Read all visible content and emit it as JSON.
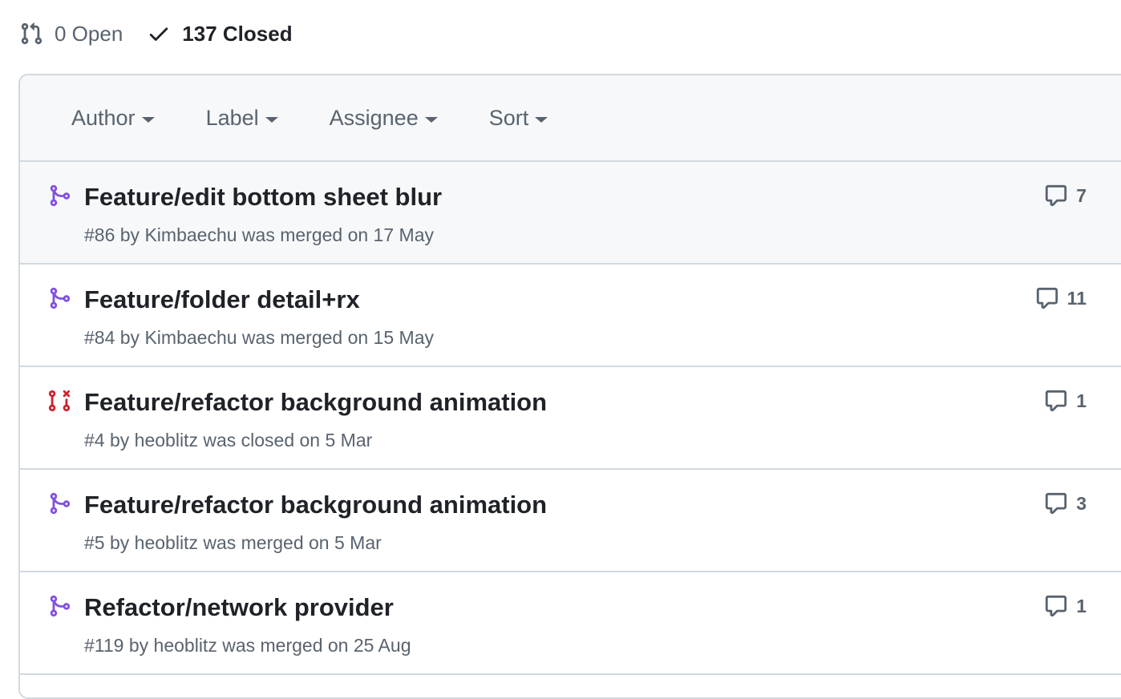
{
  "states": {
    "open_label": "0 Open",
    "closed_label": "137 Closed"
  },
  "filters": {
    "author": "Author",
    "label": "Label",
    "assignee": "Assignee",
    "sort": "Sort"
  },
  "colors": {
    "merged": "#8250df",
    "closed": "#cf222e",
    "muted": "#59636e"
  },
  "pull_requests": [
    {
      "title": "Feature/edit bottom sheet blur",
      "number": "#86",
      "by": "by",
      "author": "Kimbaechu",
      "status_text": "was merged on 17 May",
      "comments": "7",
      "state": "merged",
      "icon": "git-merge-icon"
    },
    {
      "title": "Feature/folder detail+rx",
      "number": "#84",
      "by": "by",
      "author": "Kimbaechu",
      "status_text": "was merged on 15 May",
      "comments": "11",
      "state": "merged",
      "icon": "git-merge-icon"
    },
    {
      "title": "Feature/refactor background animation",
      "number": "#4",
      "by": "by",
      "author": "heoblitz",
      "status_text": "was closed on 5 Mar",
      "comments": "1",
      "state": "closed",
      "icon": "git-pull-request-closed-icon"
    },
    {
      "title": "Feature/refactor background animation",
      "number": "#5",
      "by": "by",
      "author": "heoblitz",
      "status_text": "was merged on 5 Mar",
      "comments": "3",
      "state": "merged",
      "icon": "git-merge-icon"
    },
    {
      "title": "Refactor/network provider",
      "number": "#119",
      "by": "by",
      "author": "heoblitz",
      "status_text": "was merged on 25 Aug",
      "comments": "1",
      "state": "merged",
      "icon": "git-merge-icon"
    }
  ]
}
